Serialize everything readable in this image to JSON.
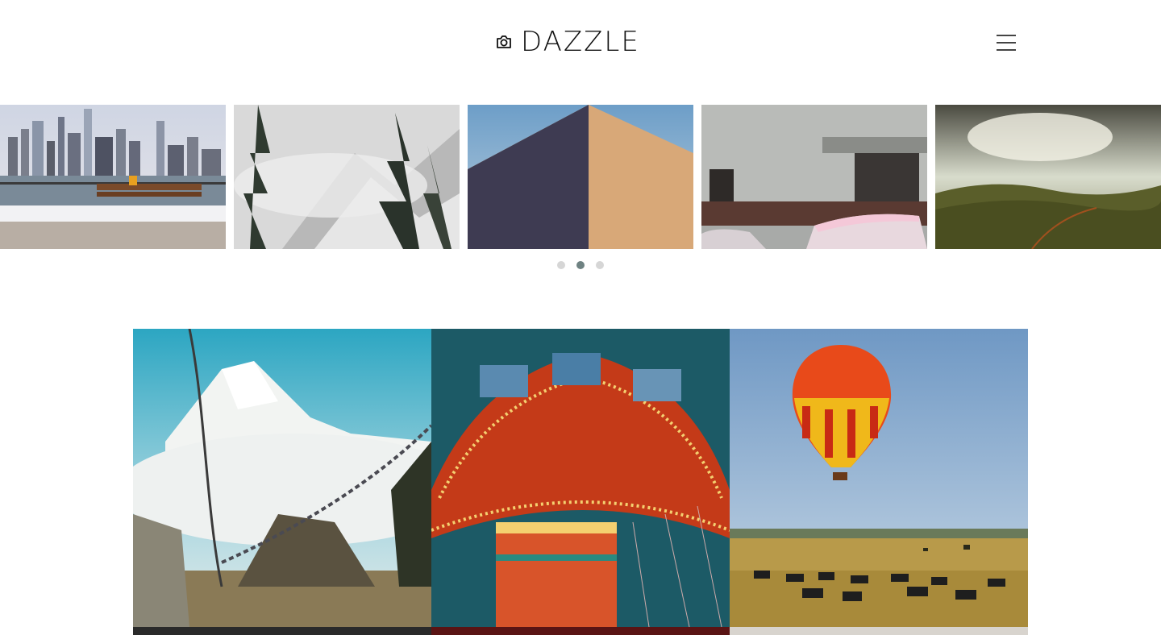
{
  "brand": {
    "name": "DAZZLE",
    "icon": "camera-icon"
  },
  "header": {
    "menu_icon": "hamburger-menu-icon"
  },
  "carousel": {
    "slides": [
      {
        "label": "city-skyline-bench"
      },
      {
        "label": "snowy-mountain-forest"
      },
      {
        "label": "sand-dune"
      },
      {
        "label": "old-building-cars"
      },
      {
        "label": "valley-sunlight"
      }
    ],
    "dots": 3,
    "active_dot": 1
  },
  "gallery": {
    "tiles": [
      {
        "label": "mountain-prayer-flags"
      },
      {
        "label": "carnival-swing-ride"
      },
      {
        "label": "hot-air-balloon-zebras"
      }
    ]
  },
  "colors": {
    "dot_inactive": "#d6d6d6",
    "dot_active": "#6f8282",
    "text": "#111111"
  }
}
